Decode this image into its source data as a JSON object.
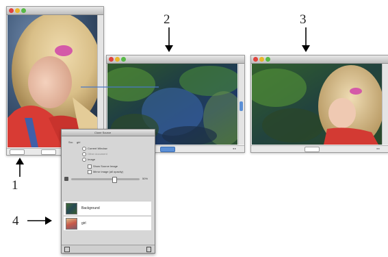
{
  "callouts": [
    "1",
    "2",
    "3",
    "4"
  ],
  "clone_source_panel": {
    "title": "Clone Source",
    "source_value": "girl",
    "mode_options": [
      "Current Window",
      "Other document",
      "Image"
    ],
    "checkbox_options": [
      "Show Source Image",
      "Mirror image (all opacity)"
    ],
    "opacity_value": "50%",
    "layers": [
      {
        "name": "Background"
      },
      {
        "name": "girl"
      }
    ]
  },
  "colors": {
    "window_chrome": "#bdbdbd",
    "close_light": "#e0443e",
    "minimize_light": "#e9b62c",
    "zoom_light": "#58b947",
    "connector_line": "#4a78c8"
  }
}
